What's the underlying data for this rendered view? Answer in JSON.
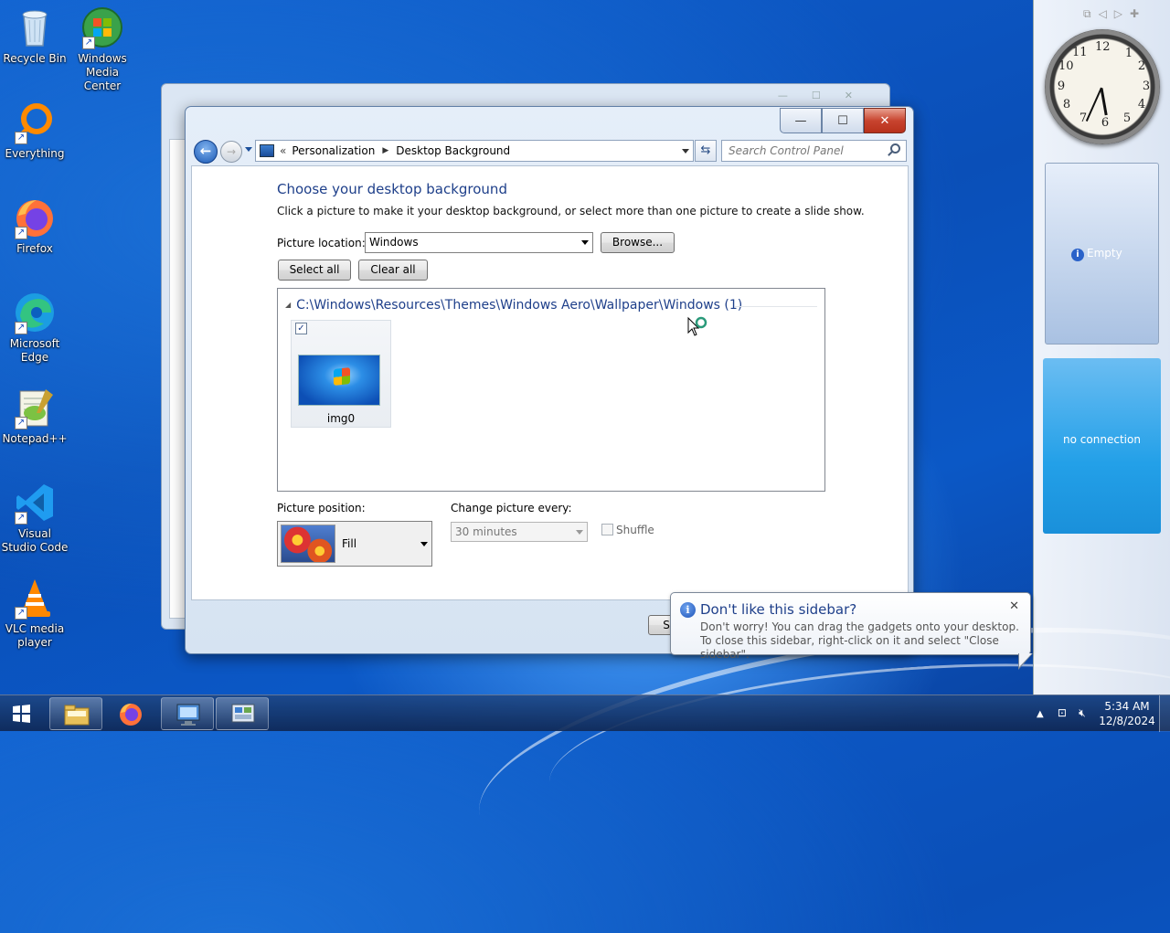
{
  "desktop": {
    "icons": [
      {
        "label": "Recycle Bin",
        "icon": "recycle-bin-icon"
      },
      {
        "label": "Windows Media Center",
        "icon": "media-center-icon"
      },
      {
        "label": "Everything",
        "icon": "everything-search-icon"
      },
      {
        "label": "Firefox",
        "icon": "firefox-icon"
      },
      {
        "label": "Microsoft Edge",
        "icon": "edge-icon"
      },
      {
        "label": "Notepad++",
        "icon": "notepadpp-icon"
      },
      {
        "label": "Visual Studio Code",
        "icon": "vscode-icon"
      },
      {
        "label": "VLC media player",
        "icon": "vlc-icon"
      }
    ]
  },
  "window": {
    "caption_buttons": {
      "minimize": "—",
      "maximize": "☐",
      "close": "✕"
    },
    "address": {
      "prefix": "«",
      "crumbs": [
        "Personalization",
        "Desktop Background"
      ]
    },
    "search_placeholder": "Search Control Panel",
    "heading": "Choose your desktop background",
    "subtext": "Click a picture to make it your desktop background, or select more than one picture to create a slide show.",
    "picture_location_label": "Picture location:",
    "picture_location_value": "Windows",
    "browse_label": "Browse...",
    "select_all_label": "Select all",
    "clear_all_label": "Clear all",
    "gallery": {
      "group_title": "C:\\Windows\\Resources\\Themes\\Windows Aero\\Wallpaper\\Windows (1)",
      "items": [
        {
          "name": "img0",
          "checked": true
        }
      ]
    },
    "picture_position_label": "Picture position:",
    "picture_position_value": "Fill",
    "change_every_label": "Change picture every:",
    "change_every_value": "30 minutes",
    "shuffle_label": "Shuffle",
    "shuffle_checked": false,
    "save_partial": "S"
  },
  "sidebar": {
    "gadget_empty_label": "Empty",
    "gadget_status": "no connection",
    "clock_time": "5:34"
  },
  "balloon": {
    "title": "Don't like this sidebar?",
    "body": "Don't worry! You can drag the gadgets onto your desktop. To close this sidebar, right-click on it and select \"Close sidebar\"."
  },
  "taskbar": {
    "time": "5:34 AM",
    "date": "12/8/2024",
    "pinned": [
      "file-explorer-icon",
      "firefox-icon",
      "remote-desktop-icon",
      "control-panel-icon"
    ]
  }
}
